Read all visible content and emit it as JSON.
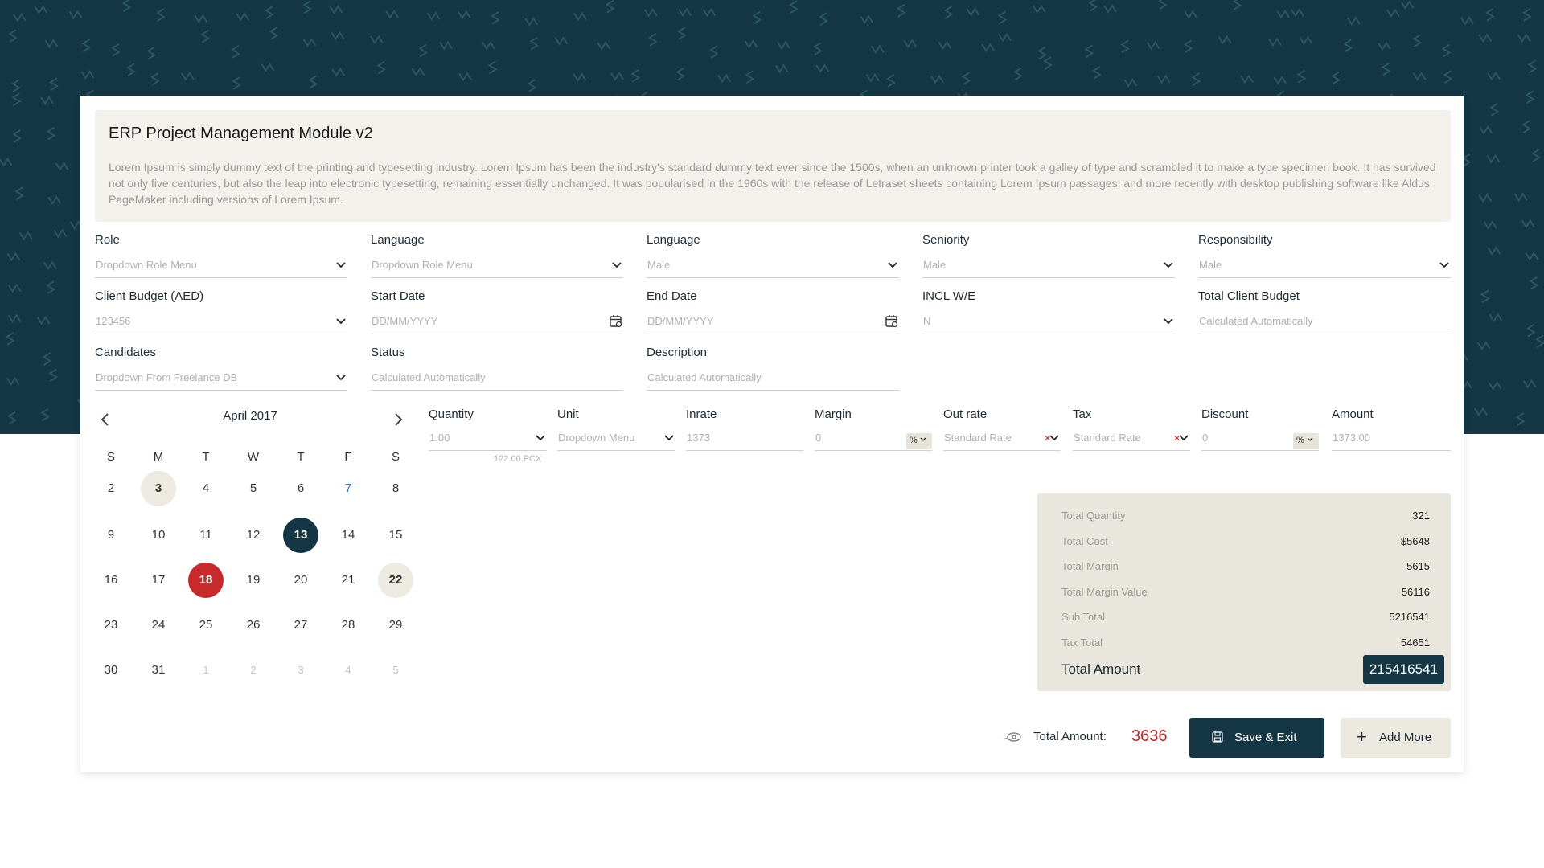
{
  "header": {
    "title": "ERP Project Management Module v2",
    "description": "Lorem Ipsum is simply dummy text of the printing and typesetting industry. Lorem Ipsum has been the industry's standard dummy text ever since the 1500s, when an unknown printer took a galley of type and scrambled it to make a type specimen book. It has survived not only five centuries, but also the leap into electronic typesetting, remaining essentially unchanged. It was popularised in the 1960s with the release of Letraset sheets containing Lorem Ipsum passages, and more recently with desktop publishing software like Aldus PageMaker including versions of Lorem Ipsum."
  },
  "form": {
    "role": {
      "label": "Role",
      "value": "Dropdown Role Menu"
    },
    "language1": {
      "label": "Language",
      "value": "Dropdown Role Menu"
    },
    "language2": {
      "label": "Language",
      "value": "Male"
    },
    "seniority": {
      "label": "Seniority",
      "value": "Male"
    },
    "responsibility": {
      "label": "Responsibility",
      "value": "Male"
    },
    "client_budget": {
      "label": "Client Budget (AED)",
      "value": "123456"
    },
    "start_date": {
      "label": "Start Date",
      "value": "DD/MM/YYYY"
    },
    "end_date": {
      "label": "End Date",
      "value": "DD/MM/YYYY"
    },
    "incl_we": {
      "label": "INCL W/E",
      "value": "N"
    },
    "total_client_budget": {
      "label": "Total Client Budget",
      "value": "Calculated Automatically"
    },
    "candidates": {
      "label": "Candidates",
      "value": "Dropdown From Freelance DB"
    },
    "status": {
      "label": "Status",
      "value": "Calculated Automatically"
    },
    "description": {
      "label": "Description",
      "value": "Calculated Automatically"
    }
  },
  "calendar": {
    "title": "April 2017",
    "weekdays": [
      "S",
      "M",
      "T",
      "W",
      "T",
      "F",
      "S"
    ],
    "weeks": [
      [
        "2",
        "3",
        "4",
        "5",
        "6",
        "7",
        "8"
      ],
      [
        "9",
        "10",
        "11",
        "12",
        "13",
        "14",
        "15"
      ],
      [
        "16",
        "17",
        "18",
        "19",
        "20",
        "21",
        "22"
      ],
      [
        "23",
        "24",
        "25",
        "26",
        "27",
        "28",
        "29"
      ],
      [
        "30",
        "31",
        "1",
        "2",
        "3",
        "4",
        "5"
      ]
    ]
  },
  "line_item": {
    "quantity": {
      "label": "Quantity",
      "value": "1.00",
      "sub": "122.00 PCX"
    },
    "unit": {
      "label": "Unit",
      "value": "Dropdown Menu"
    },
    "inrate": {
      "label": "Inrate",
      "value": "1373"
    },
    "margin": {
      "label": "Margin",
      "value": "0",
      "unit": "%"
    },
    "out_rate": {
      "label": "Out rate",
      "value": "Standard Rate"
    },
    "tax": {
      "label": "Tax",
      "value": "Standard Rate"
    },
    "discount": {
      "label": "Discount",
      "value": "0",
      "unit": "%"
    },
    "amount": {
      "label": "Amount",
      "value": "1373.00"
    }
  },
  "totals": {
    "rows": [
      {
        "label": "Total Quantity",
        "value": "321"
      },
      {
        "label": "Total Cost",
        "value": "$5648"
      },
      {
        "label": "Total Margin",
        "value": "5615"
      },
      {
        "label": "Total Margin Value",
        "value": "56116"
      },
      {
        "label": "Sub Total",
        "value": "5216541"
      },
      {
        "label": "Tax Total",
        "value": "54651"
      }
    ],
    "total_label": "Total Amount",
    "total_value": "215416541"
  },
  "footer": {
    "total_label": "Total Amount:",
    "total_value": "3636",
    "save_label": "Save & Exit",
    "add_label": "Add More"
  },
  "colors": {
    "primary": "#143645",
    "accent_red": "#c62a2a",
    "beige": "#e9e6dd"
  }
}
